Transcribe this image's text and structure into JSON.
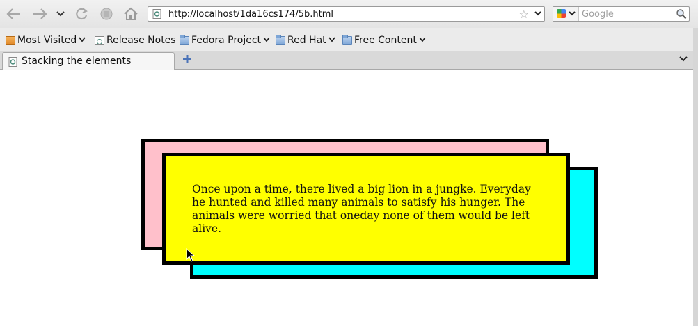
{
  "browser": {
    "url": "http://localhost/1da16cs174/5b.html",
    "search_placeholder": "Google",
    "nav_icons": [
      "back-icon",
      "forward-icon",
      "history-dropdown-icon",
      "reload-icon",
      "stop-icon",
      "home-icon"
    ]
  },
  "bookmarks": [
    {
      "label": "Most Visited",
      "icon": "most-visited-icon",
      "dropdown": true
    },
    {
      "label": "Release Notes",
      "icon": "page-icon",
      "dropdown": false
    },
    {
      "label": "Fedora Project",
      "icon": "folder-icon",
      "dropdown": true
    },
    {
      "label": "Red Hat",
      "icon": "folder-icon",
      "dropdown": true
    },
    {
      "label": "Free Content",
      "icon": "folder-icon",
      "dropdown": true
    }
  ],
  "tabs": [
    {
      "title": "Stacking the elements",
      "active": true
    }
  ],
  "page": {
    "story": "Once upon a time, there lived a big lion in a jungke. Everyday he hunted and killed many animals to satisfy his hunger. The animals were worried that oneday none of them would be left alive.",
    "colors": {
      "back_box": "#ffc0cb",
      "middle_box": "#ffff00",
      "front_box": "#00ffff",
      "border": "#000000"
    }
  }
}
